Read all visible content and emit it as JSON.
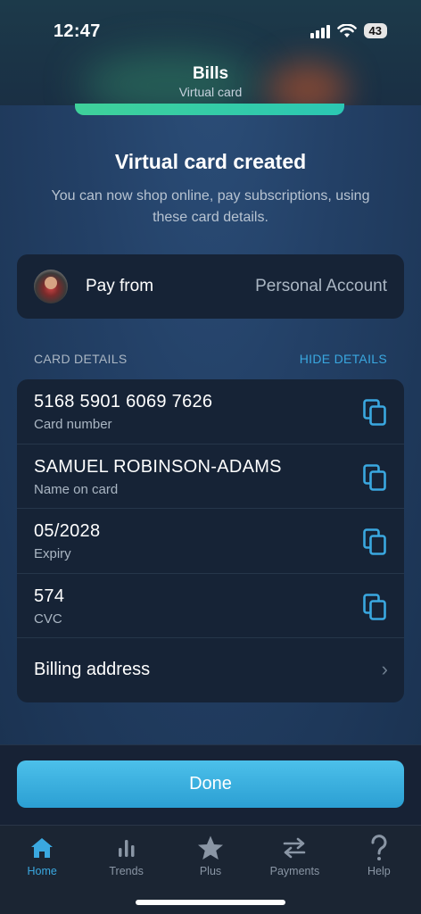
{
  "status_bar": {
    "time": "12:47",
    "battery": "43"
  },
  "nav": {
    "title": "Bills",
    "subtitle": "Virtual card"
  },
  "confirmation": {
    "title": "Virtual card created",
    "message": "You can now shop online, pay subscriptions, using these card details."
  },
  "pay_from": {
    "label": "Pay from",
    "account": "Personal Account"
  },
  "card_details": {
    "section_label": "CARD DETAILS",
    "toggle_label": "HIDE DETAILS",
    "rows": [
      {
        "value": "5168 5901 6069 7626",
        "label": "Card number"
      },
      {
        "value": "SAMUEL ROBINSON-ADAMS",
        "label": "Name on card"
      },
      {
        "value": "05/2028",
        "label": "Expiry"
      },
      {
        "value": "574",
        "label": "CVC"
      }
    ],
    "billing_label": "Billing address"
  },
  "done_button": "Done",
  "tabbar": {
    "items": [
      {
        "label": "Home",
        "icon": "home-icon",
        "active": true
      },
      {
        "label": "Trends",
        "icon": "bar-chart-icon"
      },
      {
        "label": "Plus",
        "icon": "star-icon"
      },
      {
        "label": "Payments",
        "icon": "transfer-arrows-icon"
      },
      {
        "label": "Help",
        "icon": "question-mark-icon"
      }
    ]
  },
  "colors": {
    "accent": "#3aa8e0",
    "card_bg": "#162336",
    "done_button": "#3bb2e2",
    "card_stripe": "#3fd19a"
  }
}
